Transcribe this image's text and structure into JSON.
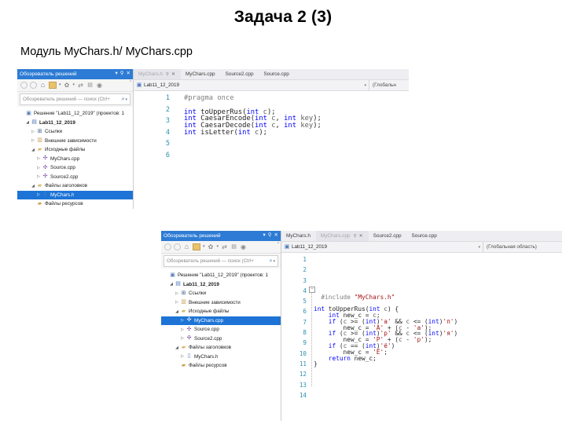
{
  "slide": {
    "title": "Задача 2 (3)",
    "subtitle": "Модуль MyChars.h/ MyChars.cpp"
  },
  "screenshot_header": {
    "panel_title": "Обозреватель решений",
    "btn_dropdown": "▾",
    "btn_pin": "⚲",
    "btn_close": "✕",
    "search_placeholder": "Обозреватель решений — поиск (Ctrl+",
    "search_icon": "search-icon",
    "search_caret": "▾",
    "toolbar_overflow": "\"",
    "toolbar_caret": "▾"
  },
  "screenshot1": {
    "tabs": [
      {
        "label": "MyChars.h",
        "active": true,
        "pin": "⚲",
        "close": "✕"
      },
      {
        "label": "MyChars.cpp",
        "active": false
      },
      {
        "label": "Source2.cpp",
        "active": false
      },
      {
        "label": "Source.cpp",
        "active": false
      }
    ],
    "navbar": {
      "scope_left": "Lab11_12_2019",
      "scope_left_caret": "▾",
      "scope_right": "(Глобальн"
    },
    "tree": [
      {
        "indent": 0,
        "expander": "",
        "icon": "ico-sln",
        "label": "Решение \"Lab11_12_2019\"  (проектов: 1",
        "selected": false,
        "bold": false
      },
      {
        "indent": 1,
        "expander": "◢",
        "icon": "ico-proj",
        "label": "Lab11_12_2019",
        "selected": false,
        "bold": true
      },
      {
        "indent": 2,
        "expander": "▷",
        "icon": "ico-ref",
        "label": "Ссылки",
        "selected": false,
        "bold": false
      },
      {
        "indent": 2,
        "expander": "▷",
        "icon": "ico-dep",
        "label": "Внешние зависимости",
        "selected": false,
        "bold": false
      },
      {
        "indent": 2,
        "expander": "◢",
        "icon": "ico-fld",
        "label": "Исходные файлы",
        "selected": false,
        "bold": false
      },
      {
        "indent": 3,
        "expander": "▷",
        "icon": "ico-cpp",
        "label": "MyChars.cpp",
        "selected": false,
        "bold": false
      },
      {
        "indent": 3,
        "expander": "▷",
        "icon": "ico-cpp",
        "label": "Source.cpp",
        "selected": false,
        "bold": false
      },
      {
        "indent": 3,
        "expander": "▷",
        "icon": "ico-cpp",
        "label": "Source2.cpp",
        "selected": false,
        "bold": false
      },
      {
        "indent": 2,
        "expander": "◢",
        "icon": "ico-fld",
        "label": "Файлы заголовков",
        "selected": false,
        "bold": false
      },
      {
        "indent": 3,
        "expander": "▷",
        "icon": "ico-h",
        "label": "MyChars.h",
        "selected": true,
        "bold": false
      },
      {
        "indent": 2,
        "expander": "",
        "icon": "ico-res",
        "label": "Файлы ресурсов",
        "selected": false,
        "bold": false
      }
    ],
    "line_numbers": [
      "1",
      "2",
      "3",
      "4",
      "5",
      "6"
    ],
    "code_lines": [
      [
        {
          "t": "#pragma once",
          "c": "prep"
        }
      ],
      [
        {
          "t": "",
          "c": "id"
        }
      ],
      [
        {
          "t": "int",
          "c": "kw"
        },
        {
          "t": " toUpperRus(",
          "c": "id"
        },
        {
          "t": "int",
          "c": "kw"
        },
        {
          "t": " ",
          "c": "id"
        },
        {
          "t": "c",
          "c": "var"
        },
        {
          "t": ");",
          "c": "punc"
        }
      ],
      [
        {
          "t": "int",
          "c": "kw"
        },
        {
          "t": " CaesarEncode(",
          "c": "id"
        },
        {
          "t": "int",
          "c": "kw"
        },
        {
          "t": " ",
          "c": "id"
        },
        {
          "t": "c",
          "c": "var"
        },
        {
          "t": ", ",
          "c": "punc"
        },
        {
          "t": "int",
          "c": "kw"
        },
        {
          "t": " ",
          "c": "id"
        },
        {
          "t": "key",
          "c": "var"
        },
        {
          "t": ");",
          "c": "punc"
        }
      ],
      [
        {
          "t": "int",
          "c": "kw"
        },
        {
          "t": " CaesarDecode(",
          "c": "id"
        },
        {
          "t": "int",
          "c": "kw"
        },
        {
          "t": " ",
          "c": "id"
        },
        {
          "t": "c",
          "c": "var"
        },
        {
          "t": ", ",
          "c": "punc"
        },
        {
          "t": "int",
          "c": "kw"
        },
        {
          "t": " ",
          "c": "id"
        },
        {
          "t": "key",
          "c": "var"
        },
        {
          "t": ");",
          "c": "punc"
        }
      ],
      [
        {
          "t": "int",
          "c": "kw"
        },
        {
          "t": " isLetter(",
          "c": "id"
        },
        {
          "t": "int",
          "c": "kw"
        },
        {
          "t": " ",
          "c": "id"
        },
        {
          "t": "c",
          "c": "var"
        },
        {
          "t": ");",
          "c": "punc"
        }
      ]
    ]
  },
  "screenshot2": {
    "tabs": [
      {
        "label": "MyChars.h",
        "active": false
      },
      {
        "label": "MyChars.cpp",
        "active": true,
        "pin": "⚲",
        "close": "✕"
      },
      {
        "label": "Source2.cpp",
        "active": false
      },
      {
        "label": "Source.cpp",
        "active": false
      }
    ],
    "navbar": {
      "scope_left": "Lab11_12_2019",
      "scope_left_caret": "▾",
      "scope_right": "(Глобальная область)"
    },
    "tree": [
      {
        "indent": 0,
        "expander": "",
        "icon": "ico-sln",
        "label": "Решение \"Lab11_12_2019\"  (проектов: 1",
        "selected": false,
        "bold": false
      },
      {
        "indent": 1,
        "expander": "◢",
        "icon": "ico-proj",
        "label": "Lab11_12_2019",
        "selected": false,
        "bold": true
      },
      {
        "indent": 2,
        "expander": "▷",
        "icon": "ico-ref",
        "label": "Ссылки",
        "selected": false,
        "bold": false
      },
      {
        "indent": 2,
        "expander": "▷",
        "icon": "ico-dep",
        "label": "Внешние зависимости",
        "selected": false,
        "bold": false
      },
      {
        "indent": 2,
        "expander": "◢",
        "icon": "ico-fld",
        "label": "Исходные файлы",
        "selected": false,
        "bold": false
      },
      {
        "indent": 3,
        "expander": "▷",
        "icon": "ico-cppsel",
        "label": "MyChars.cpp",
        "selected": true,
        "bold": false
      },
      {
        "indent": 3,
        "expander": "▷",
        "icon": "ico-cpp",
        "label": "Source.cpp",
        "selected": false,
        "bold": false
      },
      {
        "indent": 3,
        "expander": "▷",
        "icon": "ico-cpp",
        "label": "Source2.cpp",
        "selected": false,
        "bold": false
      },
      {
        "indent": 2,
        "expander": "◢",
        "icon": "ico-fld",
        "label": "Файлы заголовков",
        "selected": false,
        "bold": false
      },
      {
        "indent": 3,
        "expander": "▷",
        "icon": "ico-h",
        "label": "MyChars.h",
        "selected": false,
        "bold": false
      },
      {
        "indent": 2,
        "expander": "",
        "icon": "ico-res",
        "label": "Файлы ресурсов",
        "selected": false,
        "bold": false
      }
    ],
    "line_numbers": [
      "1",
      "2",
      "3",
      "4",
      "5",
      "6",
      "7",
      "8",
      "9",
      "10",
      "11",
      "12",
      "13",
      "14"
    ],
    "fold_marker": "−",
    "code_lines": [
      [
        {
          "t": "",
          "c": "id"
        }
      ],
      [
        {
          "t": "  #include ",
          "c": "prep"
        },
        {
          "t": "\"MyChars.h\"",
          "c": "str"
        }
      ],
      [
        {
          "t": "",
          "c": "id"
        }
      ],
      [
        {
          "t": "int",
          "c": "kw"
        },
        {
          "t": " toUpperRus(",
          "c": "id"
        },
        {
          "t": "int",
          "c": "kw"
        },
        {
          "t": " ",
          "c": "id"
        },
        {
          "t": "c",
          "c": "var"
        },
        {
          "t": ") {",
          "c": "punc"
        }
      ],
      [
        {
          "t": "    ",
          "c": "id"
        },
        {
          "t": "int",
          "c": "kw"
        },
        {
          "t": " new_c = ",
          "c": "id"
        },
        {
          "t": "c",
          "c": "var"
        },
        {
          "t": ";",
          "c": "punc"
        }
      ],
      [
        {
          "t": "    ",
          "c": "id"
        },
        {
          "t": "if",
          "c": "kw"
        },
        {
          "t": " (",
          "c": "punc"
        },
        {
          "t": "c",
          "c": "var"
        },
        {
          "t": " >= (",
          "c": "punc"
        },
        {
          "t": "int",
          "c": "kw"
        },
        {
          "t": ")",
          "c": "punc"
        },
        {
          "t": "'а'",
          "c": "chr"
        },
        {
          "t": " && ",
          "c": "punc"
        },
        {
          "t": "c",
          "c": "var"
        },
        {
          "t": " <= (",
          "c": "punc"
        },
        {
          "t": "int",
          "c": "kw"
        },
        {
          "t": ")",
          "c": "punc"
        },
        {
          "t": "'п'",
          "c": "chr"
        },
        {
          "t": ")",
          "c": "punc"
        }
      ],
      [
        {
          "t": "        new_c = ",
          "c": "id"
        },
        {
          "t": "'А'",
          "c": "chr"
        },
        {
          "t": " + (",
          "c": "punc"
        },
        {
          "t": "c",
          "c": "var"
        },
        {
          "t": " - ",
          "c": "punc"
        },
        {
          "t": "'а'",
          "c": "chr"
        },
        {
          "t": ");",
          "c": "punc"
        }
      ],
      [
        {
          "t": "    ",
          "c": "id"
        },
        {
          "t": "if",
          "c": "kw"
        },
        {
          "t": " (",
          "c": "punc"
        },
        {
          "t": "c",
          "c": "var"
        },
        {
          "t": " >= (",
          "c": "punc"
        },
        {
          "t": "int",
          "c": "kw"
        },
        {
          "t": ")",
          "c": "punc"
        },
        {
          "t": "'р'",
          "c": "chr"
        },
        {
          "t": " && ",
          "c": "punc"
        },
        {
          "t": "c",
          "c": "var"
        },
        {
          "t": " <= (",
          "c": "punc"
        },
        {
          "t": "int",
          "c": "kw"
        },
        {
          "t": ")",
          "c": "punc"
        },
        {
          "t": "'я'",
          "c": "chr"
        },
        {
          "t": ")",
          "c": "punc"
        }
      ],
      [
        {
          "t": "        new_c = ",
          "c": "id"
        },
        {
          "t": "'Р'",
          "c": "chr"
        },
        {
          "t": " + (",
          "c": "punc"
        },
        {
          "t": "c",
          "c": "var"
        },
        {
          "t": " - ",
          "c": "punc"
        },
        {
          "t": "'р'",
          "c": "chr"
        },
        {
          "t": ");",
          "c": "punc"
        }
      ],
      [
        {
          "t": "    ",
          "c": "id"
        },
        {
          "t": "if",
          "c": "kw"
        },
        {
          "t": " (",
          "c": "punc"
        },
        {
          "t": "c",
          "c": "var"
        },
        {
          "t": " == (",
          "c": "punc"
        },
        {
          "t": "int",
          "c": "kw"
        },
        {
          "t": ")",
          "c": "punc"
        },
        {
          "t": "'ё'",
          "c": "chr"
        },
        {
          "t": ")",
          "c": "punc"
        }
      ],
      [
        {
          "t": "        new_c = ",
          "c": "id"
        },
        {
          "t": "'Ё'",
          "c": "chr"
        },
        {
          "t": ";",
          "c": "punc"
        }
      ],
      [
        {
          "t": "    ",
          "c": "id"
        },
        {
          "t": "return",
          "c": "kw"
        },
        {
          "t": " new_c;",
          "c": "id"
        }
      ],
      [
        {
          "t": "}",
          "c": "punc"
        }
      ],
      [
        {
          "t": "",
          "c": "id"
        }
      ]
    ]
  }
}
